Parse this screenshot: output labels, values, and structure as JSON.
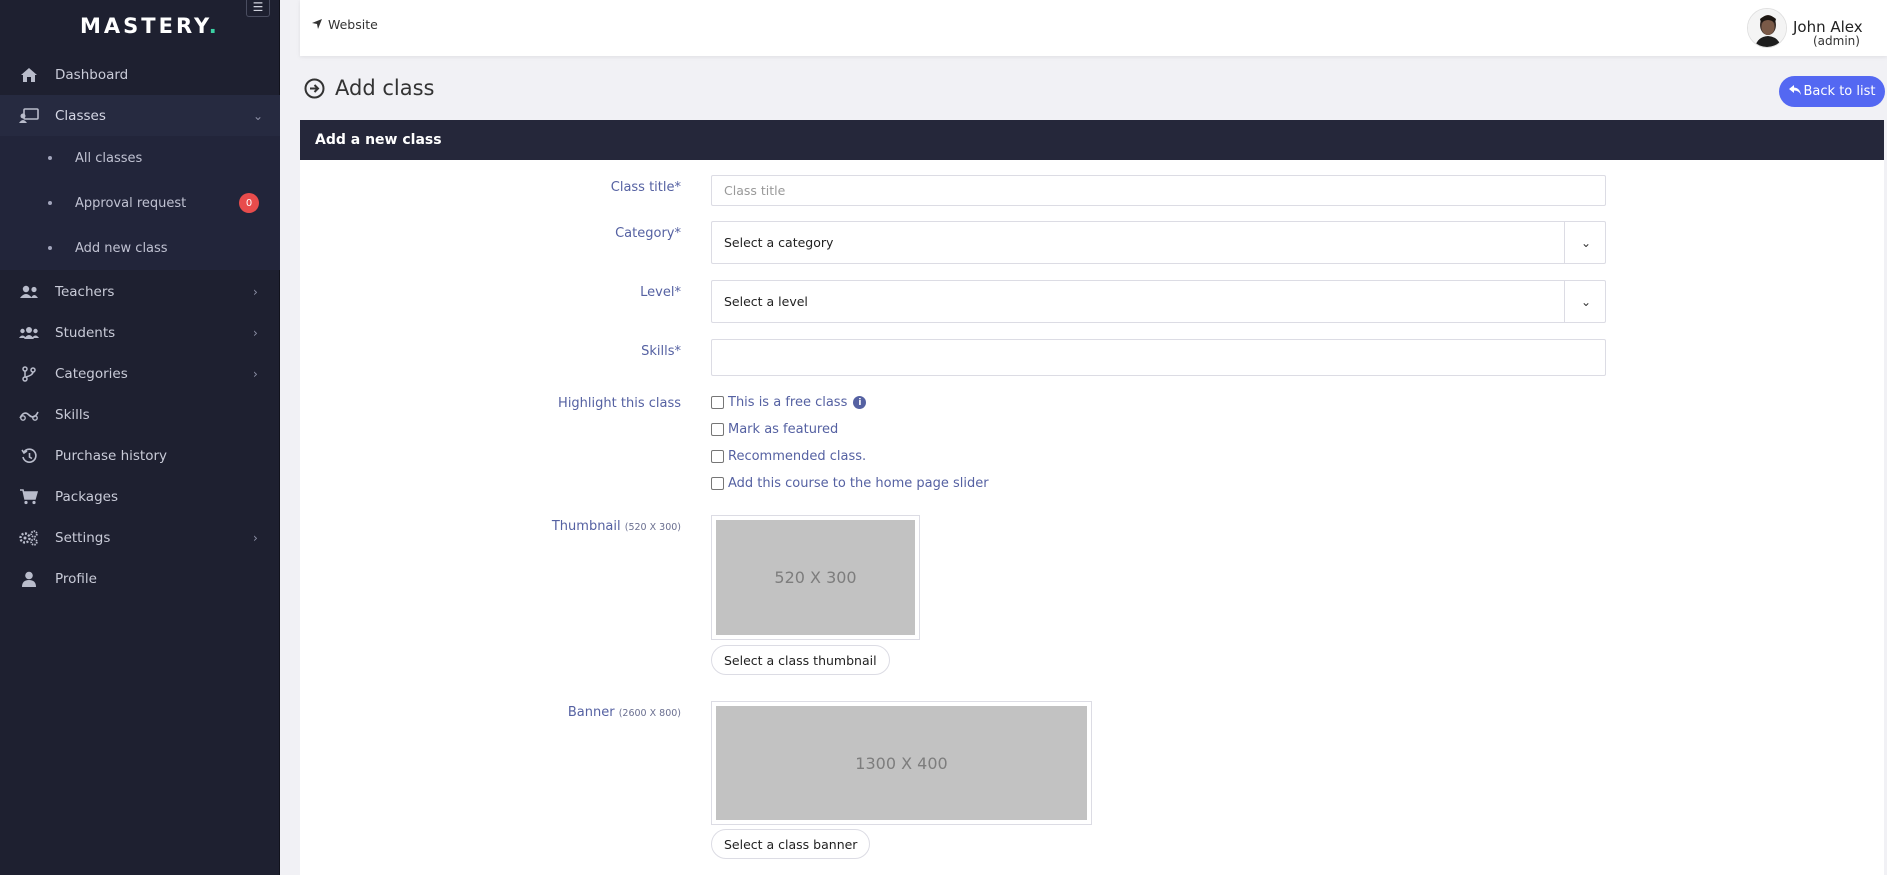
{
  "sidebar": {
    "logo": "MASTERY",
    "logo_dot": ".",
    "toggle_icon": "menu-icon",
    "items": [
      {
        "label": "Dashboard",
        "icon": "home-icon"
      },
      {
        "label": "Classes",
        "icon": "chalkboard-icon"
      },
      {
        "label": "Teachers",
        "icon": "users-icon"
      },
      {
        "label": "Students",
        "icon": "user-group-icon"
      },
      {
        "label": "Categories",
        "icon": "branch-icon"
      },
      {
        "label": "Skills",
        "icon": "skill-icon"
      },
      {
        "label": "Purchase history",
        "icon": "history-icon"
      },
      {
        "label": "Packages",
        "icon": "cart-icon"
      },
      {
        "label": "Settings",
        "icon": "gear-icon"
      },
      {
        "label": "Profile",
        "icon": "user-icon"
      }
    ],
    "submenu": [
      {
        "label": "All classes"
      },
      {
        "label": "Approval request",
        "badge": "0"
      },
      {
        "label": "Add new class"
      }
    ]
  },
  "topbar": {
    "website_label": "Website",
    "user_name": "John Alex",
    "user_role": "(admin)"
  },
  "header": {
    "title": "Add class",
    "back_label": "Back to list"
  },
  "form": {
    "card_title": "Add a new class",
    "class_title_label": "Class title*",
    "class_title_placeholder": "Class title",
    "category_label": "Category*",
    "category_value": "Select a category",
    "level_label": "Level*",
    "level_value": "Select a level",
    "skills_label": "Skills*",
    "highlight_label": "Highlight this class",
    "checkboxes": [
      {
        "label": "This is a free class",
        "checked": false
      },
      {
        "label": "Mark as featured",
        "checked": false
      },
      {
        "label": "Recommended class.",
        "checked": false
      },
      {
        "label": "Add this course to the home page slider",
        "checked": false
      }
    ],
    "thumbnail_label": "Thumbnail",
    "thumbnail_size": "(520 X 300)",
    "thumbnail_placeholder": "520 X 300",
    "thumbnail_button": "Select a class thumbnail",
    "banner_label": "Banner",
    "banner_size": "(2600 X 800)",
    "banner_placeholder": "1300 X 400",
    "banner_button": "Select a class banner"
  },
  "colors": {
    "sidebar_bg": "#1e2030",
    "accent": "#5468f2",
    "label": "#5561a2",
    "badge": "#e84c4c",
    "logo_dot": "#3bd1a3"
  }
}
